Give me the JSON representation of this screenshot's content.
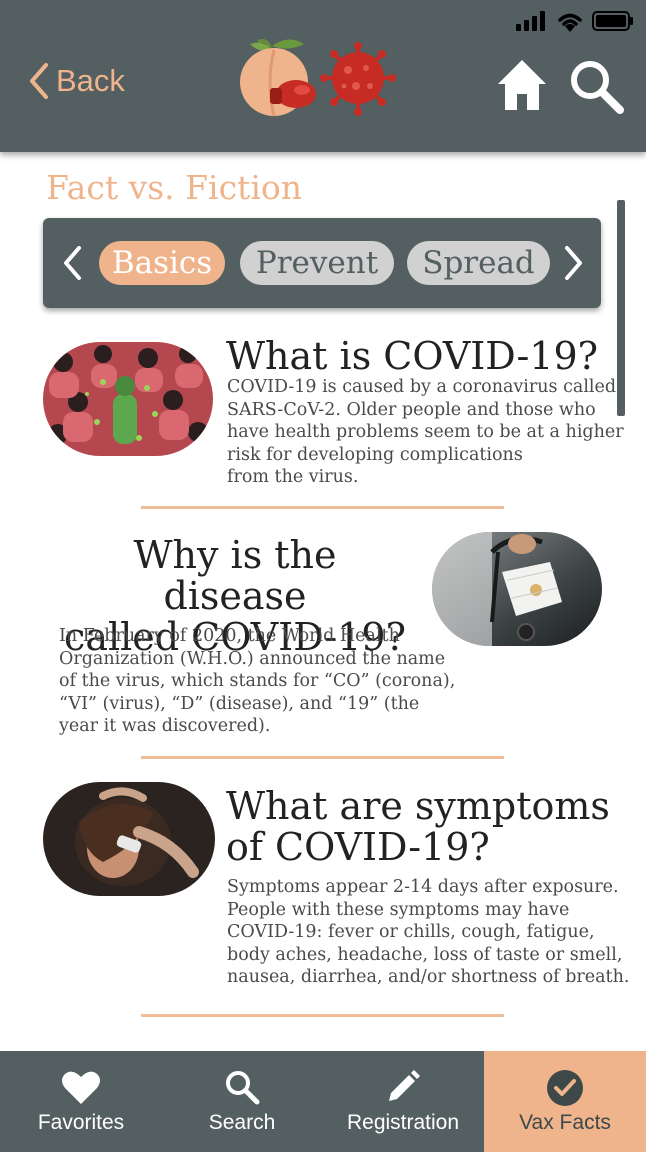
{
  "header": {
    "back_label": "Back",
    "icons": [
      "back-chevron-icon",
      "peach-vs-virus-logo",
      "home-icon",
      "search-icon"
    ],
    "status_icons": [
      "cellular-signal-icon",
      "wifi-icon",
      "battery-icon"
    ]
  },
  "page": {
    "title": "Fact vs. Fiction"
  },
  "tabs": {
    "items": [
      {
        "label": "Basics",
        "active": true
      },
      {
        "label": "Prevent",
        "active": false
      },
      {
        "label": "Spread",
        "active": false
      }
    ]
  },
  "cards": [
    {
      "title_lines": [
        "What is COVID-19?"
      ],
      "body_lines": [
        "COVID-19 is caused by a coronavirus called",
        "SARS-CoV-2. Older people and those who",
        "have health problems seem to be at a higher",
        "risk for developing complications",
        "from the virus."
      ]
    },
    {
      "title_lines": [
        "Why is the disease",
        "called COVID-19?"
      ],
      "body_lines": [
        "In February of 2020, the World Health",
        "Organization (W.H.O.) announced the name",
        "of the virus, which stands for “CO” (corona),",
        "“VI” (virus), “D” (disease), and “19” (the",
        "year it was discovered)."
      ]
    },
    {
      "title_lines": [
        "What are symptoms",
        "of COVID-19?"
      ],
      "body_lines": [
        "Symptoms appear 2-14 days after exposure.",
        "People with these symptoms may have",
        "COVID-19: fever or chills, cough, fatigue,",
        "body aches, headache, loss of taste or smell,",
        "nausea, diarrhea, and/or shortness of breath."
      ]
    }
  ],
  "bottom_nav": {
    "items": [
      {
        "label": "Favorites",
        "icon": "heart-icon",
        "active": false
      },
      {
        "label": "Search",
        "icon": "search-icon",
        "active": false
      },
      {
        "label": "Registration",
        "icon": "pencil-icon",
        "active": false
      },
      {
        "label": "Vax Facts",
        "icon": "check-circle-icon",
        "active": true
      }
    ]
  },
  "colors": {
    "header_bg": "#535f60",
    "accent_peach": "#f0b48c",
    "tab_inactive_bg": "#d1d1d1",
    "divider": "#efbd97",
    "active_nav_bg": "#efb48c"
  }
}
